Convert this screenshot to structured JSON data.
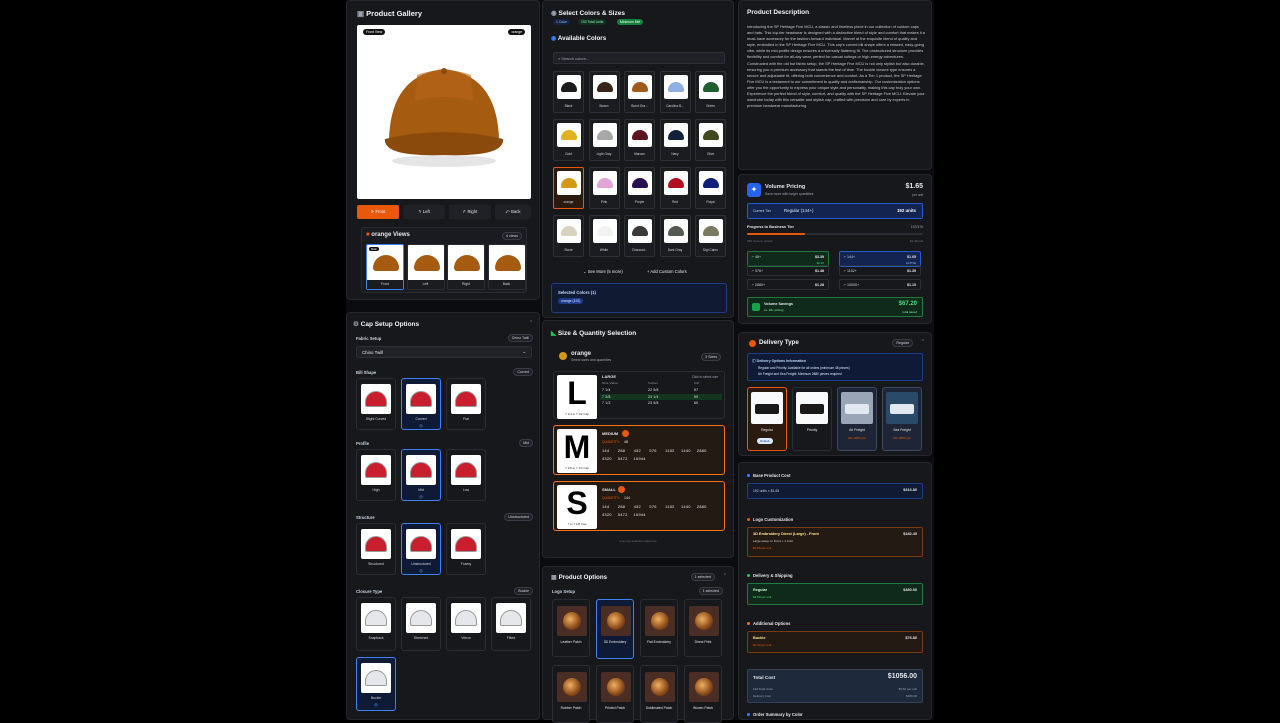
{
  "gallery": {
    "title": "Product Gallery",
    "front_badge": "Front View",
    "color_badge": "orange",
    "views": [
      "Front",
      "Left",
      "Right",
      "Back"
    ],
    "color_views_title": "orange Views",
    "views_count": "4 views",
    "front_mini_badge": "Main"
  },
  "setup": {
    "title": "Cap Setup Options",
    "fabric": {
      "label": "Fabric Setup",
      "badge": "Chino Twill",
      "value": "Chino Twill"
    },
    "bill": {
      "label": "Bill Shape",
      "badge": "Curved",
      "items": [
        "Slight Curved",
        "Curved",
        "Flat"
      ],
      "selected": 1
    },
    "profile": {
      "label": "Profile",
      "badge": "Mid",
      "items": [
        "High",
        "Mid",
        "Low"
      ],
      "selected": 1
    },
    "structure": {
      "label": "Structure",
      "badge": "Unstructured",
      "items": [
        "Structured",
        "Unstructured",
        "Foamy"
      ],
      "selected": 1
    },
    "closure": {
      "label": "Closure Type",
      "badge": "Buckle",
      "items": [
        "Snapback",
        "Stretched",
        "Velcro",
        "Fitted",
        "Buckle"
      ],
      "selected": 4
    }
  },
  "colors": {
    "title": "Select Colors & Sizes",
    "tags": [
      "1 Color",
      "192 Total Units",
      "Minimum Met"
    ],
    "available_title": "Available Colors",
    "search_placeholder": "Search colors...",
    "swatches": [
      {
        "name": "Black",
        "hex": "#1a1a1a"
      },
      {
        "name": "Brown",
        "hex": "#3a2418"
      },
      {
        "name": "Burnt Ora...",
        "hex": "#a05a1c"
      },
      {
        "name": "Carolina B...",
        "hex": "#8fb0e0"
      },
      {
        "name": "Green",
        "hex": "#1f5e2e"
      },
      {
        "name": "Gold",
        "hex": "#e2b21e"
      },
      {
        "name": "Light Gray",
        "hex": "#a8a8a8"
      },
      {
        "name": "Maroon",
        "hex": "#5e1420"
      },
      {
        "name": "Navy",
        "hex": "#14213a"
      },
      {
        "name": "Olive",
        "hex": "#3f4a20"
      },
      {
        "name": "orange",
        "hex": "#d19a12"
      },
      {
        "name": "Pink",
        "hex": "#e0a6d8"
      },
      {
        "name": "Purple",
        "hex": "#2a1050"
      },
      {
        "name": "Red",
        "hex": "#b01020"
      },
      {
        "name": "Royal",
        "hex": "#10207a"
      },
      {
        "name": "Stone",
        "hex": "#d8d2c0"
      },
      {
        "name": "White",
        "hex": "#f2f2f2"
      },
      {
        "name": "Charcoal...",
        "hex": "#3a3a3a"
      },
      {
        "name": "Dark Gray",
        "hex": "#545a50"
      },
      {
        "name": "Digi Camo",
        "hex": "#7a7a62"
      }
    ],
    "see_more": "See More (5 more)",
    "add_custom": "Add Custom Colors",
    "selected_title": "Selected Colors (1)",
    "selected_chip": "orange (192)"
  },
  "sizes": {
    "title": "Size & Quantity Selection",
    "color": "orange",
    "subtitle": "Select sizes and quantities",
    "badge": "3 Sizes",
    "large": {
      "name": "LARGE",
      "hint": "Click to select size",
      "headers": [
        "Size Value",
        "Inches",
        "CM"
      ],
      "rows": [
        [
          "7 1/4",
          "22 5/8",
          "57"
        ],
        [
          "7 3/8",
          "23 1/4",
          "59"
        ],
        [
          "7 1/2",
          "23 5/8",
          "60"
        ]
      ],
      "letter": "L",
      "sub": "7 1/4 to 7 1/2 Cap"
    },
    "medium": {
      "name": "MEDIUM",
      "qty_label": "QUANTITY:",
      "qty": "48",
      "tiers": [
        "144",
        "288",
        "432",
        "576",
        "1152",
        "1440",
        "2880"
      ],
      "tiers2": [
        "4320",
        "5472",
        "10944"
      ],
      "letter": "M",
      "sub": "7 1/8 to 7 1/4 Cap"
    },
    "small": {
      "name": "SMALL",
      "qty_label": "QUANTITY:",
      "qty": "144",
      "tiers": [
        "144",
        "288",
        "432",
        "576",
        "1152",
        "1440",
        "2880"
      ],
      "tiers2": [
        "4320",
        "5472",
        "10944"
      ],
      "letter": "S",
      "sub": "7 to 7 1/8 Cap"
    },
    "footer": "one only selection clean tee"
  },
  "options": {
    "title": "Product Options",
    "badge": "1 selected",
    "logo_label": "Logo Setup",
    "logo_badge": "1 selected",
    "items": [
      "Leather Patch",
      "3D Embroidery",
      "Flat Embroidery",
      "Direct Print",
      "Rubber Patch",
      "Printed Patch",
      "Sublimated Patch",
      "Woven Patch"
    ],
    "selected": 1
  },
  "description": {
    "title": "Product Description",
    "text": "Introducing the SP Heritage Five MCU, a classic and timeless piece in our collection of custom caps and hats. This top-tier headwear is designed with a distinctive blend of style and comfort that makes it a must-have accessory for the fashion-forward individual. Marvel at the exquisite blend of quality and style, embodied in the SP Heritage Five MCU. This cap's curved bill shape offers a relaxed, easy-going vibe, while its mid-profile design ensures a universally flattering fit. The unstructured structure provides flexibility and comfort for all-day wear, perfect for casual outings or high-energy adventures. Constructed with the old but fabric setup, the SP Heritage Five MCU is not only stylish but also durable, ensuring you a premium accessory that stands the test of time. The buckle closure type ensures a secure and adjustable fit, offering both convenience and comfort. As a Tier 1 product, the SP Heritage Five MCU is a testament to our commitment to quality and craftsmanship. Our customization options offer you the opportunity to express your unique style and personality, making this cap truly your own. Experience the perfect blend of style, comfort, and quality with the SP Heritage Five MCU. Elevate your wardrobe today with this versatile and stylish cap, crafted with precision and care by experts in premium headwear manufacturing."
  },
  "pricing": {
    "title": "Volume Pricing",
    "subtitle": "Save more with larger quantities",
    "price": "$1.65",
    "per": "per unit",
    "current_label": "Current Tier",
    "current_value": "Regular (144+)",
    "units": "192 units",
    "progress_label": "Progress to Business Tier",
    "progress_value": "192/576",
    "progress": 0.33,
    "note_left": "384 more to unlock",
    "note_right": "$1.42/unit",
    "tiers": [
      {
        "q": "48+",
        "p": "$3.39",
        "s": "$2.2X"
      },
      {
        "q": "144+",
        "p": "$1.65",
        "s": "ACTIVE"
      },
      {
        "q": "576+",
        "p": "$1.48",
        "s": ""
      },
      {
        "q": "1152+",
        "p": "$1.35",
        "s": ""
      },
      {
        "q": "2880+",
        "p": "$1.28",
        "s": ""
      },
      {
        "q": "10000+",
        "p": "$1.15",
        "s": ""
      }
    ],
    "savings_label": "Volume Savings",
    "savings_sub": "vs. 48+ pricing",
    "savings_value": "$67.20",
    "savings_note": "total saved"
  },
  "delivery": {
    "title": "Delivery Type",
    "badge": "Regular",
    "info_title": "Delivery Options Information",
    "info1": "Regular and Priority: Available for all orders (minimum 48 pieces)",
    "info2": "Air Freight and Sea Freight: Minimum 2880 pieces required",
    "items": [
      "Regular",
      "Priority",
      "Air Freight",
      "Sea Freight"
    ],
    "selected": 0,
    "selected_chip": "Default",
    "locked_note": "Min 2880 pcs"
  },
  "cost": {
    "base_label": "Base Product Cost",
    "base_line": "192 units × $1.65",
    "base_value": "$316.80",
    "logo_label": "Logo Customization",
    "logo_line": "3D Embroidery Direct (Large) - Front",
    "logo_sub": "Large setup on Front + 1 color",
    "logo_sub2": "$0.95 per unit",
    "logo_value": "$182.40",
    "ship_label": "Delivery & Shipping",
    "ship_line": "Regular",
    "ship_sub": "$2.50 per unit",
    "ship_value": "$480.00",
    "add_label": "Additional Options",
    "add_line": "Buckle",
    "add_sub": "$0.40 per unit",
    "add_value": "$76.80",
    "total_label": "Total Cost",
    "total_value": "$1056.00",
    "total_sub1": "192 Total Units",
    "total_sub1v": "$5.50 per unit",
    "total_sub2": "Delivery Cost",
    "total_sub2v": "$480.00",
    "summary_label": "Order Summary by Color"
  },
  "colors_theme": {
    "orange": "#ea580c",
    "blue": "#3b82f6",
    "green": "#22c55e"
  }
}
